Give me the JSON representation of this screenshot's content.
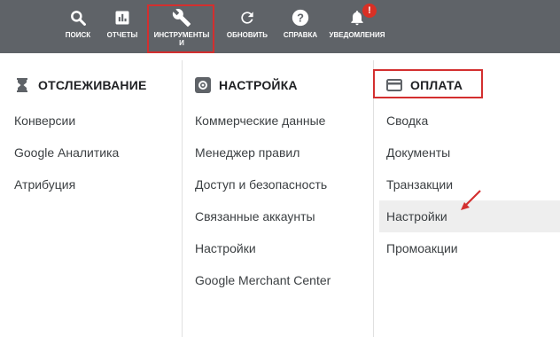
{
  "topbar": {
    "items": [
      {
        "label": "ПОИСК",
        "icon": "search-icon"
      },
      {
        "label": "ОТЧЕТЫ",
        "icon": "bar-chart-icon"
      },
      {
        "label": "ИНСТРУМЕНТЫ И",
        "icon": "wrench-icon"
      },
      {
        "label": "ОБНОВИТЬ",
        "icon": "refresh-icon"
      },
      {
        "label": "СПРАВКА",
        "icon": "help-icon"
      },
      {
        "label": "УВЕДОМЛЕНИЯ",
        "icon": "bell-icon"
      }
    ],
    "notification_badge": "!"
  },
  "sections": [
    {
      "title": "ОТСЛЕЖИВАНИЕ",
      "icon": "hourglass-icon",
      "items": [
        "Конверсии",
        "Google Аналитика",
        "Атрибуция"
      ]
    },
    {
      "title": "НАСТРОЙКА",
      "icon": "gear-icon",
      "items": [
        "Коммерческие данные",
        "Менеджер правил",
        "Доступ и безопасность",
        "Связанные аккаунты",
        "Настройки",
        "Google Merchant Center"
      ]
    },
    {
      "title": "ОПЛАТА",
      "icon": "credit-card-icon",
      "items": [
        "Сводка",
        "Документы",
        "Транзакции",
        "Настройки",
        "Промоакции"
      ]
    }
  ],
  "colors": {
    "topbar_bg": "#5f6368",
    "highlight_border": "#d32f2f",
    "active_item_bg": "#eeeeee",
    "badge": "#d93025"
  }
}
